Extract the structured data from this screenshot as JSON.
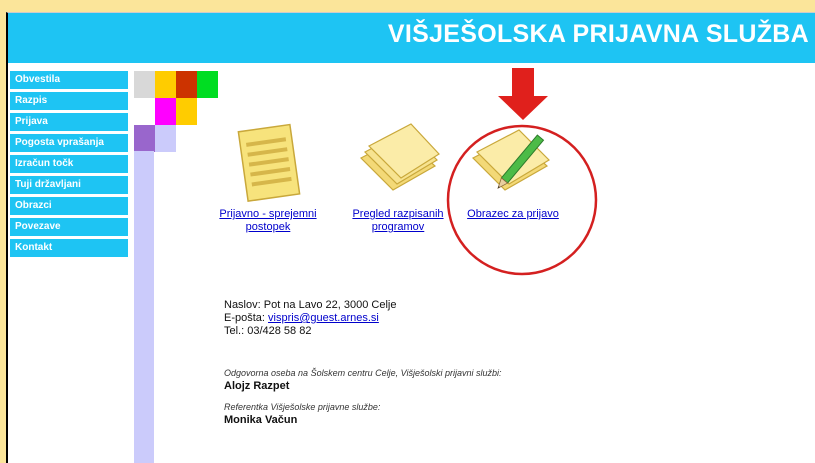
{
  "header": {
    "title": "VIŠJEŠOLSKA PRIJAVNA SLUŽBA"
  },
  "nav": {
    "items": [
      {
        "label": "Obvestila"
      },
      {
        "label": "Razpis"
      },
      {
        "label": "Prijava"
      },
      {
        "label": "Pogosta vprašanja"
      },
      {
        "label": "Izračun točk"
      },
      {
        "label": "Tuji državljani"
      },
      {
        "label": "Obrazci"
      },
      {
        "label": "Povezave"
      },
      {
        "label": "Kontakt"
      }
    ]
  },
  "cards": [
    {
      "label_line1": "Prijavno - sprejemni",
      "label_line2": "postopek",
      "icon": "document-icon"
    },
    {
      "label_line1": "Pregled razpisanih",
      "label_line2": "programov",
      "icon": "papers-stack-icon"
    },
    {
      "label_line1": "Obrazec za prijavo",
      "label_line2": "",
      "icon": "form-pencil-icon"
    }
  ],
  "contact": {
    "address": "Naslov: Pot na Lavo 22, 3000 Celje",
    "email_prefix": "E-pošta: ",
    "email": "vispris@guest.arnes.si",
    "phone": "Tel.: 03/428 58 82"
  },
  "responsible": {
    "label": "Odgovorna oseba na Šolskem centru Celje, Višješolski prijavni službi:",
    "name": "Alojz Razpet"
  },
  "referent": {
    "label": "Referentka Višješolske prijavne službe:",
    "name": "Monika Vačun"
  },
  "colors": {
    "header": "#1ec4f3",
    "highlight_circle": "#d42020",
    "arrow": "#e0201c"
  }
}
